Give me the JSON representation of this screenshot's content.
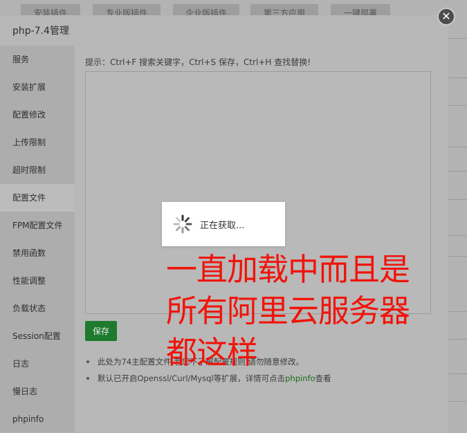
{
  "background": {
    "tabs": [
      "安装插件",
      "专业版插件",
      "企业版插件",
      "第三方应用",
      "一键部署"
    ]
  },
  "dialog": {
    "title": "php-7.4管理",
    "close_glyph": "✕"
  },
  "sidebar": {
    "items": [
      {
        "label": "服务"
      },
      {
        "label": "安装扩展"
      },
      {
        "label": "配置修改"
      },
      {
        "label": "上传限制"
      },
      {
        "label": "超时限制"
      },
      {
        "label": "配置文件",
        "active": true
      },
      {
        "label": "FPM配置文件"
      },
      {
        "label": "禁用函数"
      },
      {
        "label": "性能调整"
      },
      {
        "label": "负载状态"
      },
      {
        "label": "Session配置"
      },
      {
        "label": "日志"
      },
      {
        "label": "慢日志"
      },
      {
        "label": "phpinfo"
      }
    ]
  },
  "content": {
    "hint": "提示：Ctrl+F 搜索关键字，Ctrl+S 保存，Ctrl+H 查找替换!",
    "save_label": "保存",
    "notes": [
      {
        "text": "此处为74主配置文件,若您不了解配置规则,请勿随意修改。"
      },
      {
        "prefix": "默认已开启Openssl/Curl/Mysql等扩展，详情可点击",
        "link": "phpinfo",
        "suffix": "查看"
      }
    ]
  },
  "loading": {
    "text": "正在获取..."
  },
  "annotation": {
    "lines": [
      "一直加载中而且是",
      "所有阿里云服务器",
      "都这样"
    ],
    "color": "#f0140a"
  },
  "colors": {
    "save_button": "#1d7a2e",
    "link": "#1a6b1a"
  }
}
